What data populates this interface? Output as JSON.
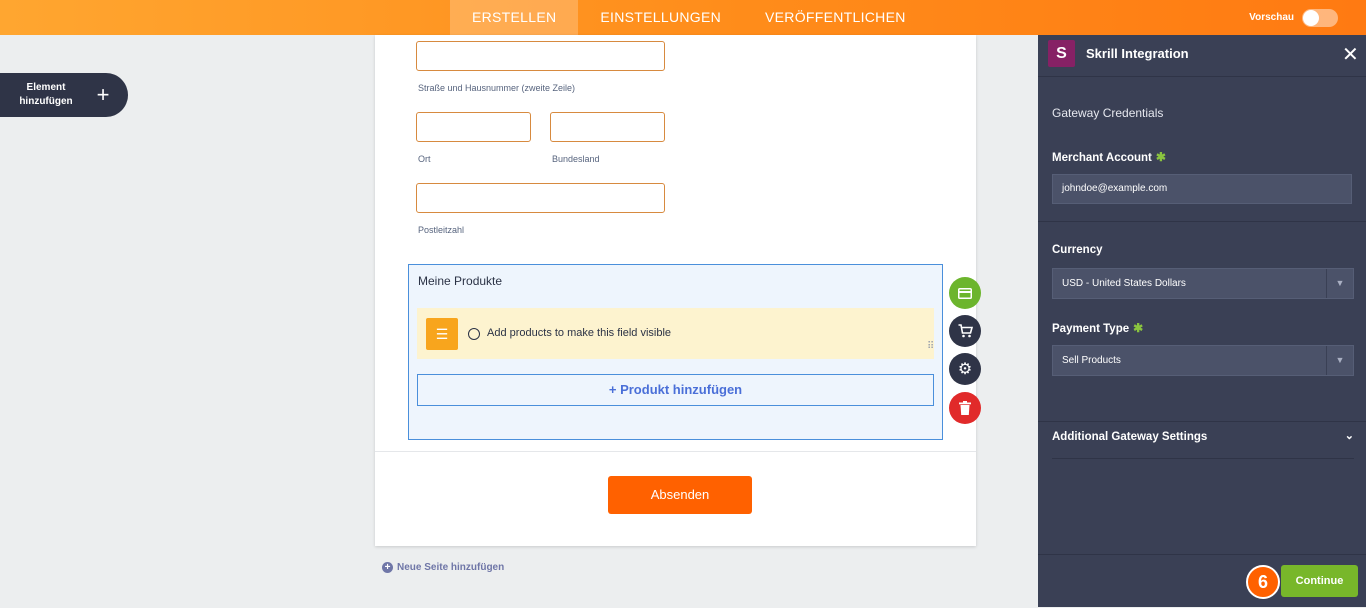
{
  "topbar": {
    "tabs": [
      {
        "label": "ERSTELLEN"
      },
      {
        "label": "EINSTELLUNGEN"
      },
      {
        "label": "VERÖFFENTLICHEN"
      }
    ],
    "preview_label": "Vorschau"
  },
  "left": {
    "add_element_label_line1": "Element",
    "add_element_label_line2": "hinzufügen"
  },
  "form": {
    "address_line2_label": "Straße und Hausnummer (zweite Zeile)",
    "city_label": "Ort",
    "state_label": "Bundesland",
    "zip_label": "Postleitzahl",
    "products": {
      "title": "Meine Produkte",
      "notice": "Add products to make this field visible",
      "add_button": "+ Produkt hinzufügen"
    },
    "submit_label": "Absenden",
    "new_page_label": "Neue Seite hinzufügen"
  },
  "actions": [
    {
      "icon": "payment-card-icon",
      "color": "#6cb52d"
    },
    {
      "icon": "cart-icon",
      "color": "#2f3447"
    },
    {
      "icon": "gear-icon",
      "color": "#2f3447"
    },
    {
      "icon": "trash-icon",
      "color": "#e12a2a"
    }
  ],
  "panel": {
    "logo_letter": "S",
    "title": "Skrill Integration",
    "section_title": "Gateway Credentials",
    "merchant_label": "Merchant Account",
    "merchant_value": "johndoe@example.com",
    "currency_label": "Currency",
    "currency_value": "USD - United States Dollars",
    "payment_type_label": "Payment Type",
    "payment_type_value": "Sell Products",
    "additional_label": "Additional Gateway Settings",
    "step_number": "6",
    "continue_label": "Continue"
  },
  "colors": {
    "accent": "#ff7a12",
    "panel_bg": "#3a4055",
    "skrill_brand": "#862165",
    "continue": "#78b72a"
  }
}
